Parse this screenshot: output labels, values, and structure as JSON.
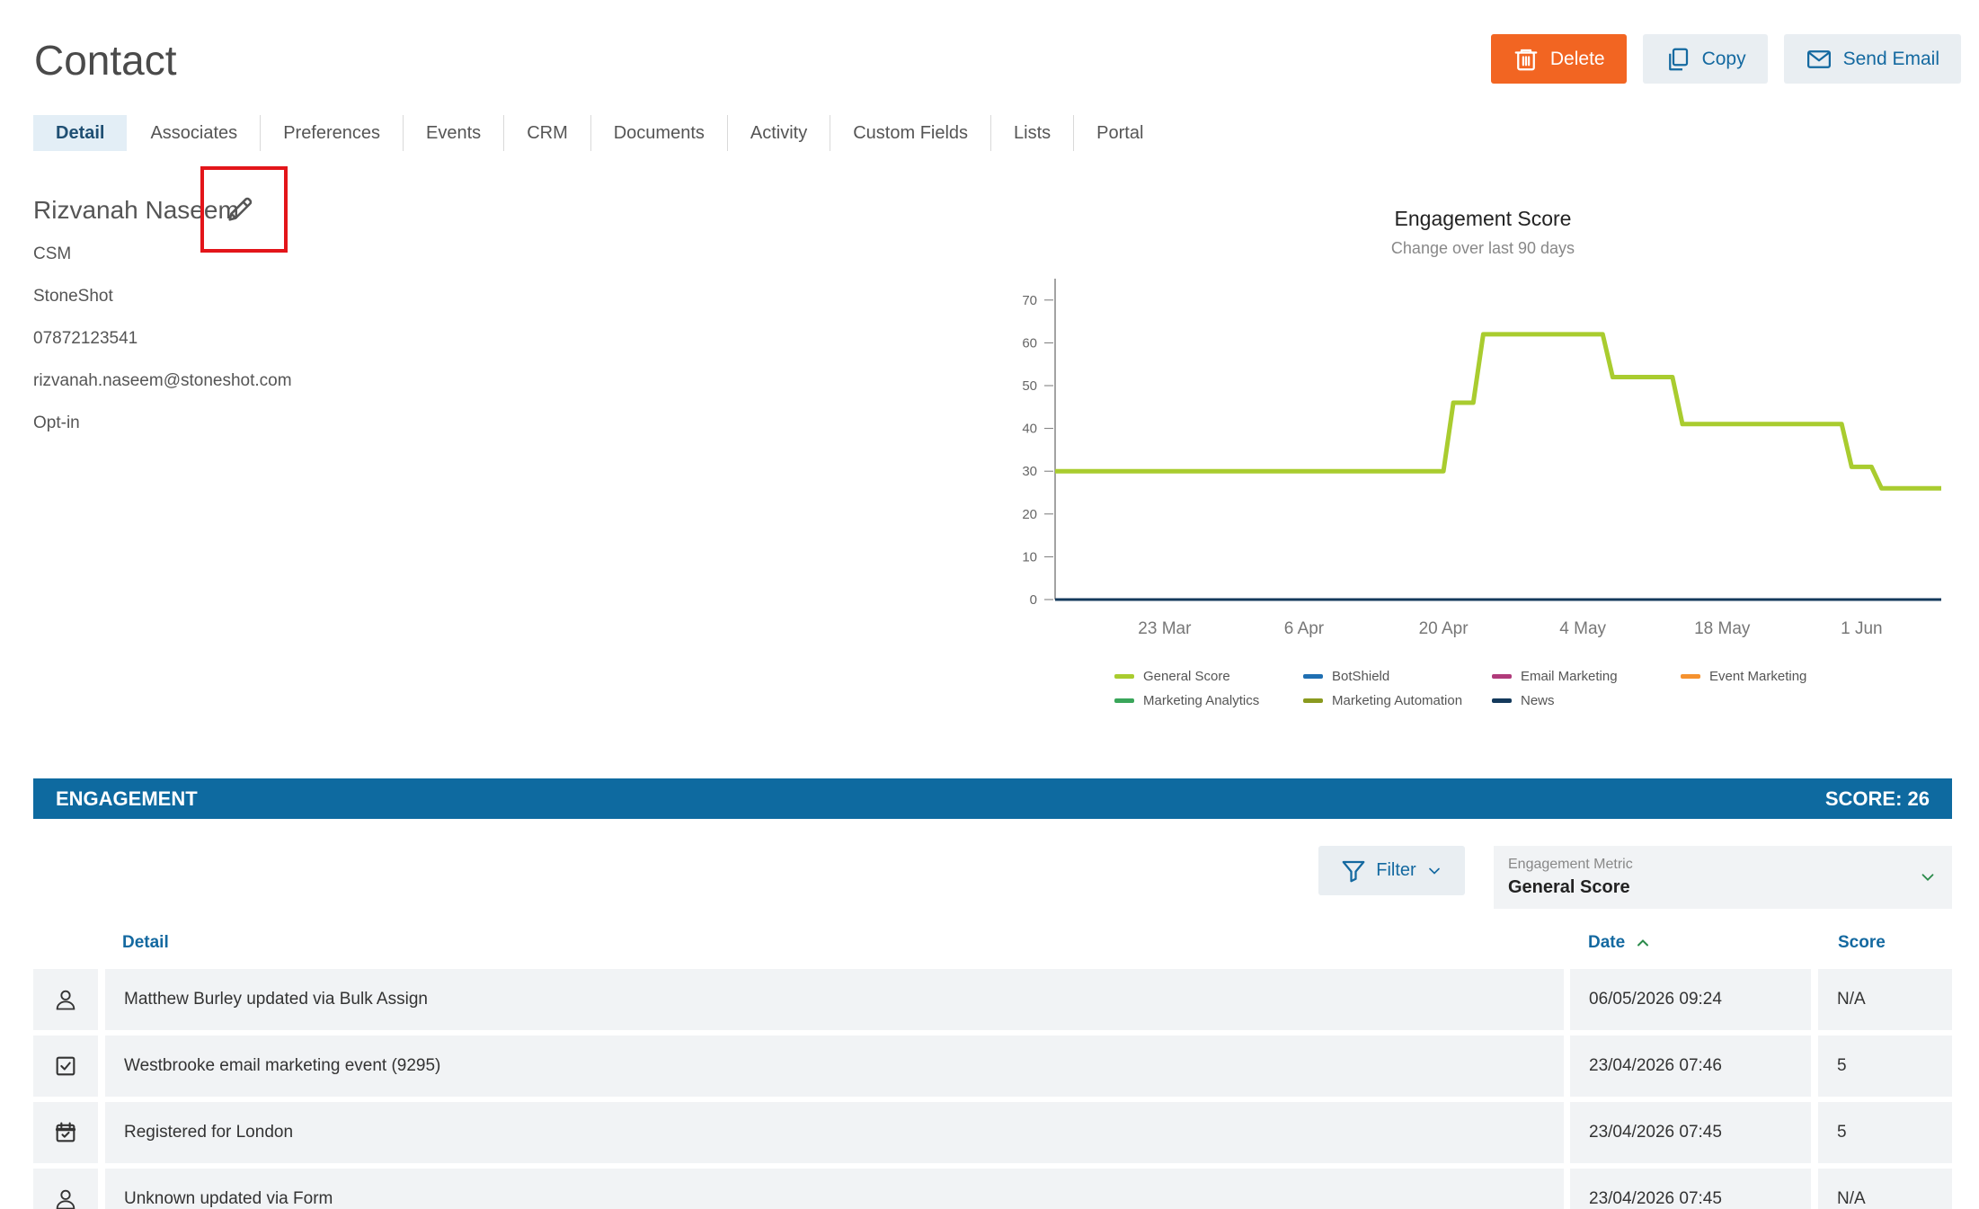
{
  "page": {
    "title": "Contact"
  },
  "actions": {
    "delete": "Delete",
    "copy": "Copy",
    "send_email": "Send Email"
  },
  "tabs": [
    "Detail",
    "Associates",
    "Preferences",
    "Events",
    "CRM",
    "Documents",
    "Activity",
    "Custom Fields",
    "Lists",
    "Portal"
  ],
  "contact": {
    "name": "Rizvanah Naseem",
    "role": "CSM",
    "company": "StoneShot",
    "phone": "07872123541",
    "email": "rizvanah.naseem@stoneshot.com",
    "consent": "Opt-in"
  },
  "chart_data": {
    "type": "line",
    "title": "Engagement Score",
    "subtitle": "Change over last 90 days",
    "ylim": [
      0,
      75
    ],
    "yticks": [
      0,
      10,
      20,
      30,
      40,
      50,
      60,
      70
    ],
    "xlim": [
      "2026-03-12",
      "2026-06-09"
    ],
    "xticks": [
      {
        "label": "23 Mar",
        "date": "2026-03-23"
      },
      {
        "label": "6 Apr",
        "date": "2026-04-06"
      },
      {
        "label": "20 Apr",
        "date": "2026-04-20"
      },
      {
        "label": "4 May",
        "date": "2026-05-04"
      },
      {
        "label": "18 May",
        "date": "2026-05-18"
      },
      {
        "label": "1 Jun",
        "date": "2026-06-01"
      }
    ],
    "grid": false,
    "legend_position": "bottom",
    "series": [
      {
        "name": "General Score",
        "color": "#a9cc2f",
        "points": [
          [
            "2026-03-12",
            30
          ],
          [
            "2026-04-20",
            30
          ],
          [
            "2026-04-20",
            30
          ],
          [
            "2026-04-21",
            46
          ],
          [
            "2026-04-23",
            46
          ],
          [
            "2026-04-24",
            62
          ],
          [
            "2026-05-06",
            62
          ],
          [
            "2026-05-07",
            52
          ],
          [
            "2026-05-13",
            52
          ],
          [
            "2026-05-14",
            41
          ],
          [
            "2026-05-30",
            41
          ],
          [
            "2026-05-31",
            31
          ],
          [
            "2026-06-02",
            31
          ],
          [
            "2026-06-03",
            26
          ],
          [
            "2026-06-09",
            26
          ]
        ]
      },
      {
        "name": "BotShield",
        "color": "#1f6fb2",
        "points": [
          [
            "2026-03-12",
            0
          ],
          [
            "2026-06-09",
            0
          ]
        ]
      },
      {
        "name": "Email Marketing",
        "color": "#b03a7a",
        "points": [
          [
            "2026-03-12",
            0
          ],
          [
            "2026-06-09",
            0
          ]
        ]
      },
      {
        "name": "Event Marketing",
        "color": "#f5922f",
        "points": [
          [
            "2026-03-12",
            0
          ],
          [
            "2026-06-09",
            0
          ]
        ]
      },
      {
        "name": "Marketing Analytics",
        "color": "#3aa65a",
        "points": [
          [
            "2026-03-12",
            0
          ],
          [
            "2026-06-09",
            0
          ]
        ]
      },
      {
        "name": "Marketing Automation",
        "color": "#8a9a1f",
        "points": [
          [
            "2026-03-12",
            0
          ],
          [
            "2026-06-09",
            0
          ]
        ]
      },
      {
        "name": "News",
        "color": "#143a5c",
        "points": [
          [
            "2026-03-12",
            0
          ],
          [
            "2026-06-09",
            0
          ]
        ]
      }
    ]
  },
  "engagement": {
    "title": "ENGAGEMENT",
    "score_text": "SCORE: 26",
    "filter_label": "Filter",
    "metric_label": "Engagement Metric",
    "metric_value": "General Score",
    "columns": {
      "detail": "Detail",
      "date": "Date",
      "score": "Score"
    },
    "rows": [
      {
        "icon": "person-icon",
        "detail": "Matthew Burley updated via Bulk Assign",
        "date": "06/05/2026 09:24",
        "score": "N/A"
      },
      {
        "icon": "checkbox-icon",
        "detail": "Westbrooke email marketing event (9295)",
        "date": "23/04/2026 07:46",
        "score": "5"
      },
      {
        "icon": "calendar-check-icon",
        "detail": "Registered for London",
        "date": "23/04/2026 07:45",
        "score": "5"
      },
      {
        "icon": "person-icon",
        "detail": "Unknown updated via Form",
        "date": "23/04/2026 07:45",
        "score": "N/A"
      }
    ]
  },
  "colors": {
    "accent": "#f26522",
    "primary": "#0e6aa0",
    "highlight": "#e3151a"
  }
}
